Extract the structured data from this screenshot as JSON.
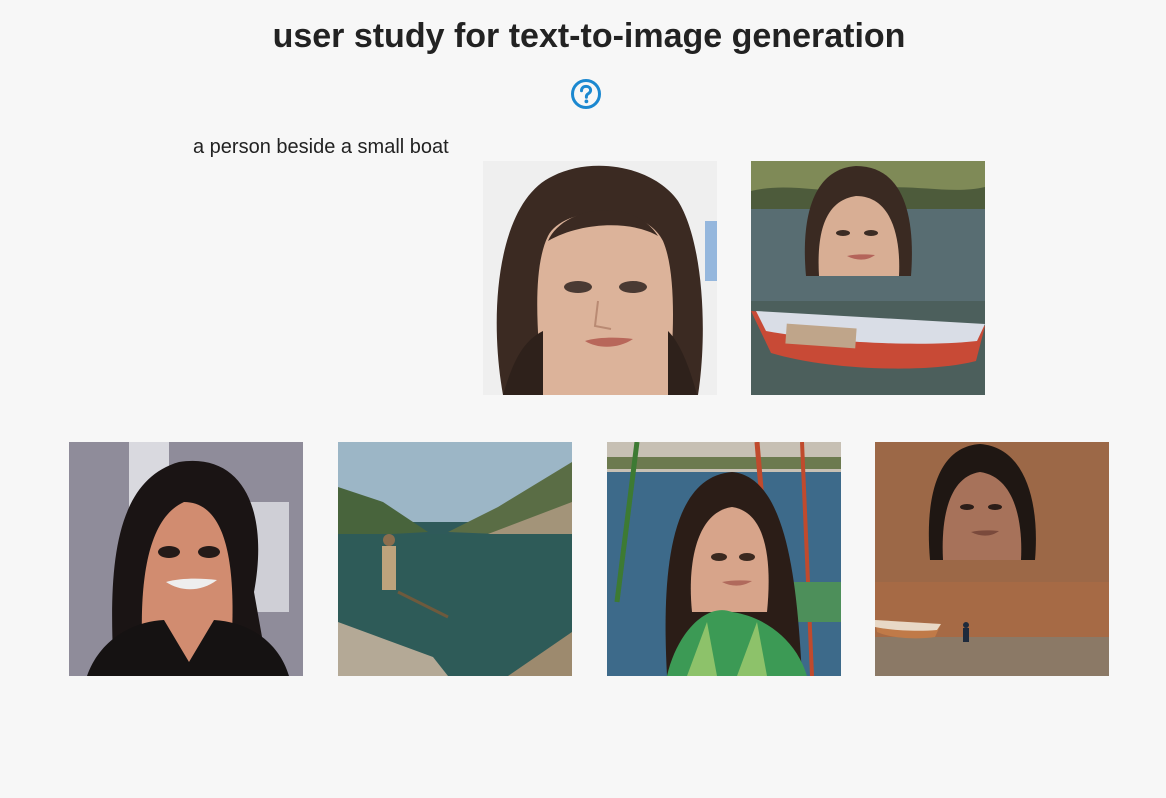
{
  "header": {
    "title": "user study for text-to-image generation"
  },
  "help": {
    "icon": "question-circle-icon",
    "color": "#1b88d0"
  },
  "prompt": {
    "text": "a person beside a small boat"
  },
  "reference_images": [
    {
      "name": "reference-face-image",
      "description": "close-up portrait of a dark-haired woman"
    },
    {
      "name": "reference-composite-image",
      "description": "woman's face pasted over a lake with a small red rowboat"
    }
  ],
  "candidate_images": [
    {
      "name": "candidate-image-1",
      "description": "smiling dark-haired woman with dramatic makeup on gray backdrop"
    },
    {
      "name": "candidate-image-2",
      "description": "person standing in rowboat on a mountain lake"
    },
    {
      "name": "candidate-image-3",
      "description": "woman in green top beside boats on water"
    },
    {
      "name": "candidate-image-4",
      "description": "face floating over a brown shore with a small boat and tiny figure"
    }
  ]
}
